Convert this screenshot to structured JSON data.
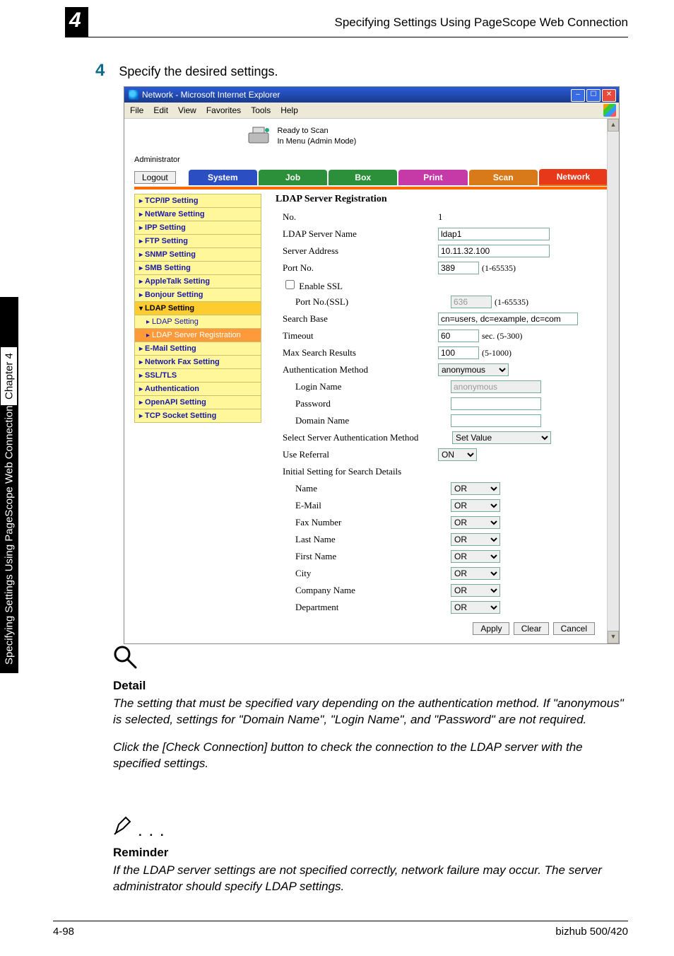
{
  "header": {
    "section_number": "4",
    "title": "Specifying Settings Using PageScope Web Connection"
  },
  "side": {
    "chapter": "Chapter 4",
    "label": "Specifying Settings Using PageScope Web Connection"
  },
  "step": {
    "num": "4",
    "text": "Specify the desired settings."
  },
  "ie": {
    "title": "Network - Microsoft Internet Explorer",
    "menus": {
      "file": "File",
      "edit": "Edit",
      "view": "View",
      "favorites": "Favorites",
      "tools": "Tools",
      "help": "Help"
    },
    "status1": "Ready to Scan",
    "status2": "In Menu (Admin Mode)",
    "admin": "Administrator",
    "logout": "Logout",
    "tabs": {
      "system": "System",
      "job": "Job",
      "box": "Box",
      "print": "Print",
      "scan": "Scan",
      "network": "Network"
    }
  },
  "sidenav": {
    "tcpip": "TCP/IP Setting",
    "netware": "NetWare Setting",
    "ipp": "IPP Setting",
    "ftp": "FTP Setting",
    "snmp": "SNMP Setting",
    "smb": "SMB Setting",
    "appletalk": "AppleTalk Setting",
    "bonjour": "Bonjour Setting",
    "ldap": "LDAP Setting",
    "ldap_setting": "LDAP Setting",
    "ldap_reg": "LDAP Server Registration",
    "email": "E-Mail Setting",
    "netfax": "Network Fax Setting",
    "ssl": "SSL/TLS",
    "auth": "Authentication",
    "openapi": "OpenAPI Setting",
    "tcpsock": "TCP Socket Setting"
  },
  "content": {
    "heading": "LDAP Server Registration",
    "no_lbl": "No.",
    "no_val": "1",
    "server_name_lbl": "LDAP Server Name",
    "server_name_val": "ldap1",
    "addr_lbl": "Server Address",
    "addr_val": "10.11.32.100",
    "port_lbl": "Port No.",
    "port_val": "389",
    "port_hint": "(1-65535)",
    "enable_ssl_lbl": "Enable SSL",
    "port_ssl_lbl": "Port No.(SSL)",
    "port_ssl_val": "636",
    "port_ssl_hint": "(1-65535)",
    "search_base_lbl": "Search Base",
    "search_base_val": "cn=users, dc=example, dc=com",
    "timeout_lbl": "Timeout",
    "timeout_val": "60",
    "timeout_hint": "sec. (5-300)",
    "max_lbl": "Max Search Results",
    "max_val": "100",
    "max_hint": "(5-1000)",
    "auth_method_lbl": "Authentication Method",
    "auth_method_val": "anonymous",
    "login_lbl": "Login Name",
    "login_val": "anonymous",
    "pwd_lbl": "Password",
    "domain_lbl": "Domain Name",
    "select_auth_lbl": "Select Server Authentication Method",
    "select_auth_val": "Set Value",
    "referral_lbl": "Use Referral",
    "referral_val": "ON",
    "init_lbl": "Initial Setting for Search Details",
    "name_lbl": "Name",
    "email_lbl": "E-Mail",
    "fax_lbl": "Fax Number",
    "last_lbl": "Last Name",
    "first_lbl": "First Name",
    "city_lbl": "City",
    "company_lbl": "Company Name",
    "dept_lbl": "Department",
    "or": "OR",
    "apply": "Apply",
    "clear": "Clear",
    "cancel": "Cancel"
  },
  "detail": {
    "title": "Detail",
    "p1": "The setting that must be specified vary depending on the authentication method. If \"anonymous\" is selected, settings for \"Domain Name\", \"Login Name\", and \"Password\" are not required.",
    "p2": "Click the [Check Connection] button to check the connection to the LDAP server with the specified settings."
  },
  "reminder": {
    "title": "Reminder",
    "p1": "If the LDAP server settings are not specified correctly, network failure may occur. The server administrator should specify LDAP settings."
  },
  "footer": {
    "page": "4-98",
    "model": "bizhub 500/420"
  }
}
